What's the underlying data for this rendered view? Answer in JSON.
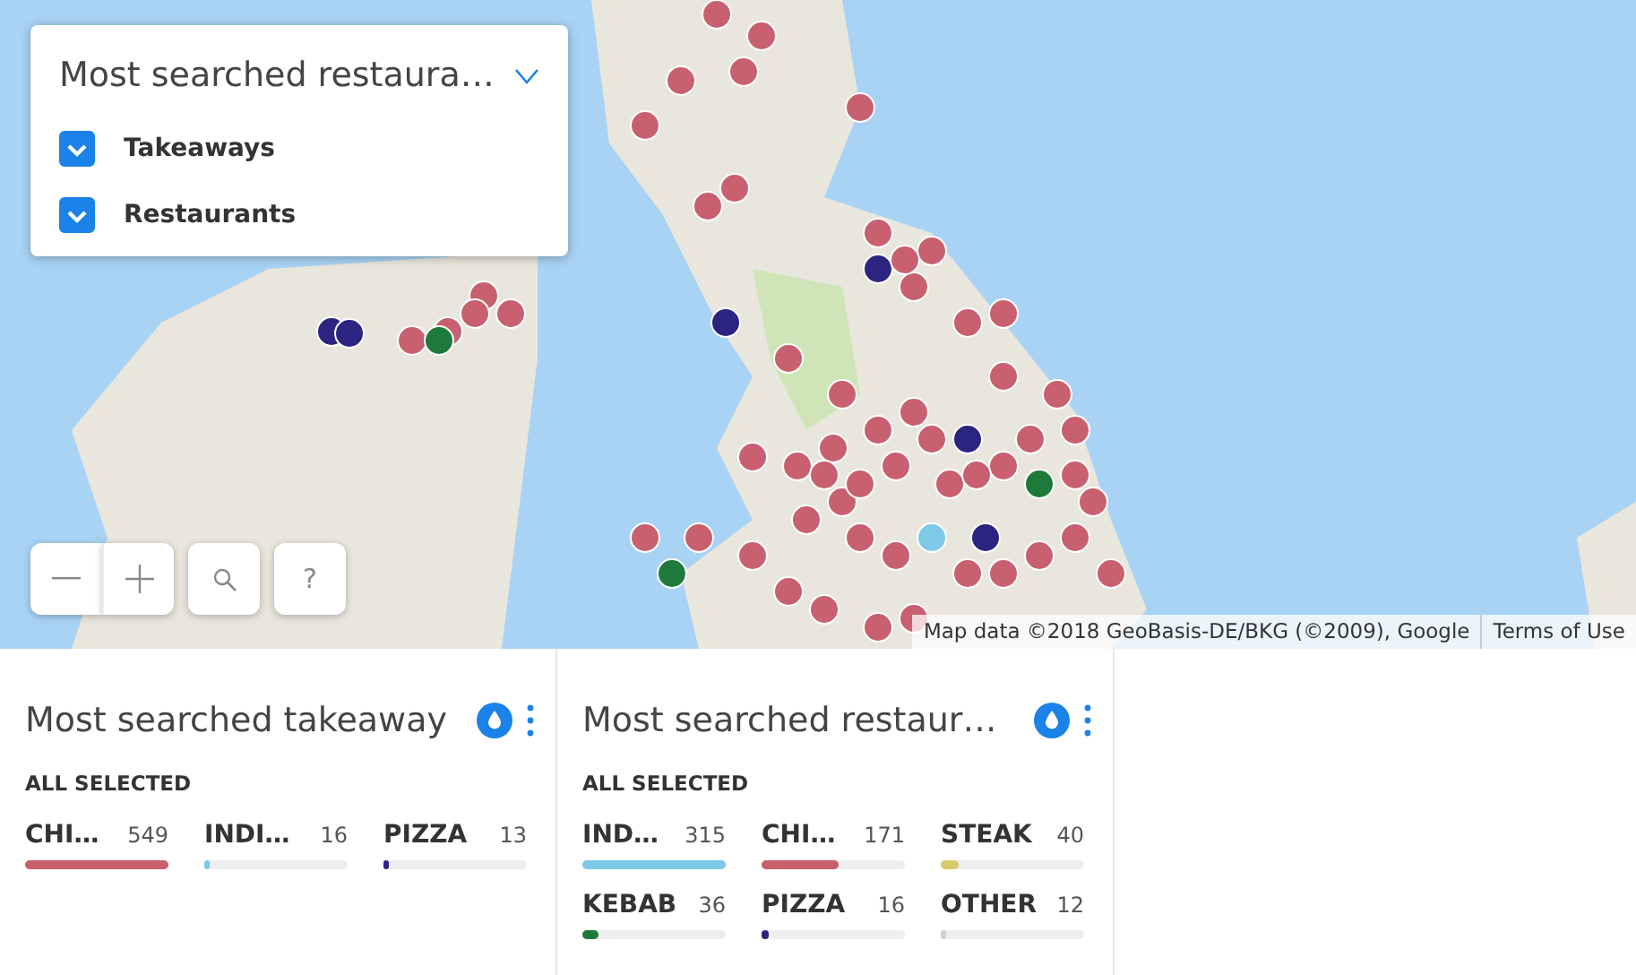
{
  "filter_panel": {
    "title": "Most searched restaura…",
    "expanded": false,
    "options": [
      {
        "label": "Takeaways",
        "checked": true
      },
      {
        "label": "Restaurants",
        "checked": true
      }
    ]
  },
  "map_controls": {
    "help": "?"
  },
  "attribution": {
    "text": "Map data ©2018 GeoBasis-DE/BKG (©2009), Google",
    "link": "Terms of Use"
  },
  "panels": [
    {
      "title": "Most searched takeaway",
      "subtitle": "ALL SELECTED",
      "items": [
        {
          "label": "CHI…",
          "count": "549",
          "level": 1.0,
          "color": "#c9606f"
        },
        {
          "label": "INDI…",
          "count": "16",
          "level": 0.03,
          "color": "#7ec8e8"
        },
        {
          "label": "PIZZA",
          "count": "13",
          "level": 0.024,
          "color": "#2b2480"
        }
      ]
    },
    {
      "title": "Most searched restaur…",
      "subtitle": "ALL SELECTED",
      "items": [
        {
          "label": "IND…",
          "count": "315",
          "level": 1.0,
          "color": "#7ec8e8"
        },
        {
          "label": "CHI…",
          "count": "171",
          "level": 0.54,
          "color": "#c9606f"
        },
        {
          "label": "STEAK",
          "count": "40",
          "level": 0.13,
          "color": "#d9c96a"
        },
        {
          "label": "KEBAB",
          "count": "36",
          "level": 0.11,
          "color": "#1e7a3a"
        },
        {
          "label": "PIZZA",
          "count": "16",
          "level": 0.05,
          "color": "#2b2480"
        },
        {
          "label": "OTHER",
          "count": "12",
          "level": 0.04,
          "color": "#d0d0d0"
        }
      ]
    }
  ]
}
